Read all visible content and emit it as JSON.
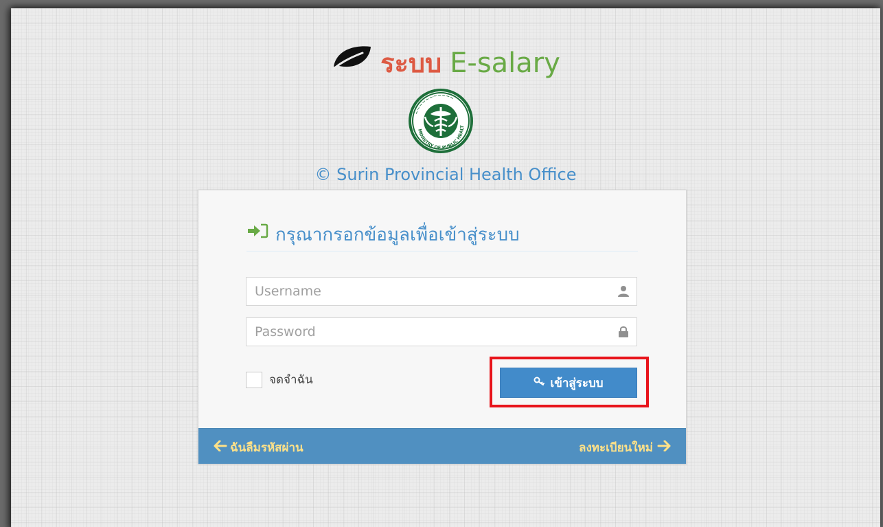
{
  "header": {
    "title_thai": "ระบบ",
    "title_brand": "E-salary",
    "leaf_icon": "leaf-icon",
    "seal_icon": "ministry-of-public-health-seal",
    "copyright": "© Surin Provincial Health Office"
  },
  "login": {
    "title": "กรุณากรอกข้อมูลเพื่อเข้าสู่ระบบ",
    "title_icon": "sign-in-icon",
    "username": {
      "placeholder": "Username",
      "value": "",
      "icon": "user-icon"
    },
    "password": {
      "placeholder": "Password",
      "value": "",
      "icon": "lock-icon"
    },
    "remember_label": "จดจำฉัน",
    "remember_checked": false,
    "submit_label": "เข้าสู่ระบบ",
    "submit_icon": "key-icon"
  },
  "footer": {
    "forgot_label": "ฉันลืมรหัสผ่าน",
    "register_label": "ลงทะเบียนใหม่"
  },
  "colors": {
    "title_thai": "#dd5a43",
    "title_brand": "#69aa46",
    "accent_blue": "#478fca",
    "button_blue": "#428bca",
    "footer_blue": "#5090c1",
    "footer_link": "#fee188",
    "highlight": "#e8141b"
  }
}
